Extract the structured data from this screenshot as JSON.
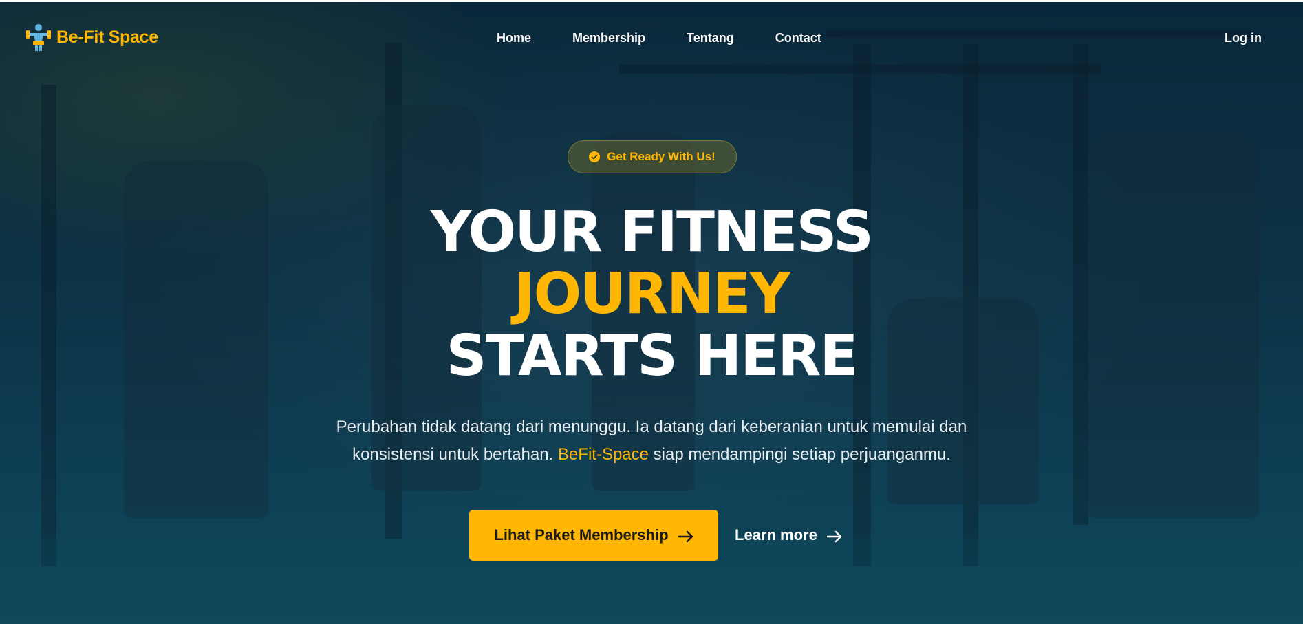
{
  "brand": {
    "name": "Be-Fit Space",
    "icon": "weightlifter-icon",
    "color": "#ffb703"
  },
  "nav": {
    "links": [
      "Home",
      "Membership",
      "Tentang",
      "Contact"
    ],
    "login_label": "Log in"
  },
  "hero": {
    "badge_text": "Get Ready With Us!",
    "badge_icon": "check-circle-icon",
    "headline_line1": "YOUR FITNESS",
    "headline_line2": "JOURNEY",
    "headline_line3": "STARTS HERE",
    "subtitle_part1": "Perubahan tidak datang dari menunggu. Ia datang dari keberanian untuk memulai dan konsistensi untuk bertahan. ",
    "subtitle_brand": "BeFit-Space",
    "subtitle_part2": " siap mendampingi setiap perjuanganmu.",
    "primary_cta_label": "Lihat Paket Membership",
    "secondary_cta_label": "Learn more",
    "cta_icon": "arrow-right-icon"
  },
  "colors": {
    "accent": "#ffb703",
    "background": "#0e3347",
    "text": "#ffffff"
  }
}
